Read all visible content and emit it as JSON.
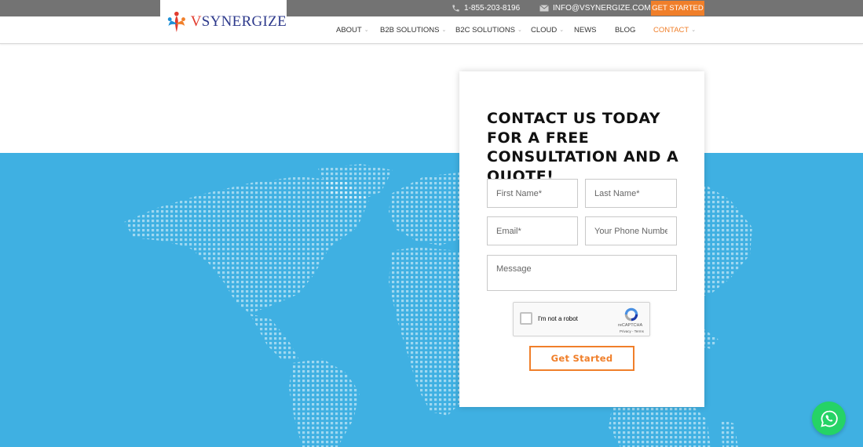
{
  "topbar": {
    "phone": "1-855-203-8196",
    "email": "INFO@VSYNERGIZE.COM",
    "cta": "GET STARTED"
  },
  "brand": {
    "initial": "V",
    "rest": "SYNERGIZE"
  },
  "nav": {
    "items": [
      {
        "label": "ABOUT"
      },
      {
        "label": "B2B SOLUTIONS"
      },
      {
        "label": "B2C SOLUTIONS"
      },
      {
        "label": "CLOUD"
      },
      {
        "label": "NEWS"
      },
      {
        "label": "BLOG"
      },
      {
        "label": "CONTACT"
      }
    ]
  },
  "form": {
    "title": "CONTACT US TODAY FOR A FREE CONSULTATION AND A QUOTE!",
    "first_name_placeholder": "First Name*",
    "last_name_placeholder": "Last Name*",
    "email_placeholder": "Email*",
    "phone_placeholder": "Your Phone Number",
    "message_placeholder": "Message",
    "captcha_label": "I'm not a robot",
    "captcha_brand": "reCAPTCHA",
    "captcha_terms": "Privacy - Terms",
    "submit_label": "Get Started"
  },
  "colors": {
    "accent": "#f07f2a",
    "topbar": "#737373",
    "map_bg": "#3fb0e2",
    "whatsapp": "#25d366"
  },
  "icons": {
    "phone": "phone-icon",
    "mail": "mail-icon",
    "logo": "logo-icon",
    "recaptcha": "recaptcha-icon",
    "whatsapp": "whatsapp-icon"
  }
}
